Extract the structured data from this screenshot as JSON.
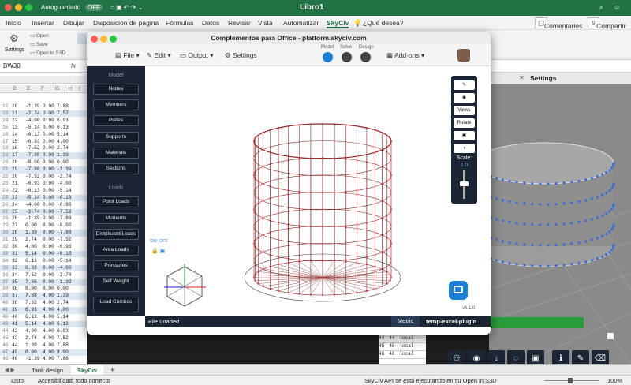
{
  "excel": {
    "autosave_label": "Autoguardado",
    "autosave_state": "OFF",
    "title": "Libro1",
    "tabs": [
      "Inicio",
      "Insertar",
      "Dibujar",
      "Disposición de página",
      "Fórmulas",
      "Datos",
      "Revisar",
      "Vista",
      "Automatizar",
      "SkyCiv"
    ],
    "active_tab": "SkyCiv",
    "tell_me": "¿Qué desea?",
    "comments_label": "Comentarios",
    "share_label": "Compartir",
    "ribbon": {
      "settings": "Settings",
      "open": "Open",
      "save": "Save",
      "open_s3d": "Open in S3D"
    },
    "name_box": "BW30",
    "fx": "fx",
    "col_headers": [
      "D",
      "E",
      "F",
      "G",
      "H",
      "I"
    ],
    "sheet_tabs": [
      "Tank design",
      "SkyCiv"
    ],
    "active_sheet": "SkyCiv",
    "status_ready": "Listo",
    "status_accessibility": "Accesibilidad: todo correcto",
    "status_plugin": "SkyCiv API se está ejecutando en su Open in S3D",
    "zoom": "100%",
    "rows": [
      [
        "12",
        "10",
        "-1.39",
        "0.00",
        "7.88"
      ],
      [
        "13",
        "11",
        "-2.74",
        "0.00",
        "7.52"
      ],
      [
        "14",
        "12",
        "-4.00",
        "0.00",
        "6.93"
      ],
      [
        "15",
        "13",
        "-5.14",
        "0.00",
        "6.13"
      ],
      [
        "16",
        "14",
        "-6.13",
        "0.00",
        "5.14"
      ],
      [
        "17",
        "15",
        "-6.93",
        "0.00",
        "4.00"
      ],
      [
        "18",
        "16",
        "-7.52",
        "0.00",
        "2.74"
      ],
      [
        "19",
        "17",
        "-7.88",
        "0.00",
        "1.39"
      ],
      [
        "20",
        "18",
        "-8.00",
        "0.00",
        "0.00"
      ],
      [
        "21",
        "19",
        "-7.88",
        "0.00",
        "-1.39"
      ],
      [
        "22",
        "20",
        "-7.52",
        "0.00",
        "-2.74"
      ],
      [
        "23",
        "21",
        "-6.93",
        "0.00",
        "-4.00"
      ],
      [
        "24",
        "22",
        "-6.13",
        "0.00",
        "-5.14"
      ],
      [
        "25",
        "23",
        "-5.14",
        "0.00",
        "-6.13"
      ],
      [
        "26",
        "24",
        "-4.00",
        "0.00",
        "-6.93"
      ],
      [
        "27",
        "25",
        "-2.74",
        "0.00",
        "-7.52"
      ],
      [
        "28",
        "26",
        "-1.39",
        "0.00",
        "-7.88"
      ],
      [
        "29",
        "27",
        "0.00",
        "0.00",
        "-8.00"
      ],
      [
        "30",
        "28",
        "1.39",
        "0.00",
        "-7.88"
      ],
      [
        "31",
        "29",
        "2.74",
        "0.00",
        "-7.52"
      ],
      [
        "32",
        "30",
        "4.00",
        "0.00",
        "-6.93"
      ],
      [
        "33",
        "31",
        "5.14",
        "0.00",
        "-6.13"
      ],
      [
        "34",
        "32",
        "6.13",
        "0.00",
        "-5.14"
      ],
      [
        "35",
        "33",
        "6.93",
        "0.00",
        "-4.00"
      ],
      [
        "36",
        "34",
        "7.52",
        "0.00",
        "-2.74"
      ],
      [
        "37",
        "35",
        "7.86",
        "0.00",
        "-1.39"
      ],
      [
        "38",
        "36",
        "8.00",
        "0.00",
        "0.00"
      ],
      [
        "39",
        "37",
        "7.88",
        "4.00",
        "1.39"
      ],
      [
        "40",
        "38",
        "7.52",
        "4.00",
        "2.74"
      ],
      [
        "41",
        "39",
        "6.93",
        "4.00",
        "4.00"
      ],
      [
        "42",
        "40",
        "6.13",
        "4.00",
        "5.14"
      ],
      [
        "43",
        "41",
        "5.14",
        "4.00",
        "6.13"
      ],
      [
        "44",
        "42",
        "4.00",
        "4.00",
        "6.93"
      ],
      [
        "45",
        "43",
        "2.74",
        "4.00",
        "7.52"
      ],
      [
        "46",
        "44",
        "1.39",
        "4.00",
        "7.88"
      ],
      [
        "47",
        "45",
        "0.00",
        "4.00",
        "8.00"
      ],
      [
        "48",
        "46",
        "-1.39",
        "4.00",
        "7.88"
      ]
    ],
    "right_cells": [
      [
        "44",
        "44",
        "local"
      ],
      [
        "45",
        "45",
        "local"
      ],
      [
        "46",
        "46",
        "local"
      ]
    ]
  },
  "plugin": {
    "title": "Complementos para Office - platform.skyciv.com",
    "menu": [
      "File",
      "Edit",
      "Output",
      "Settings"
    ],
    "steps": [
      "Model",
      "Solve",
      "Design"
    ],
    "addons": "Add-ons",
    "side_model_header": "Model",
    "side_model": [
      "Nodes",
      "Members",
      "Plates",
      "Supports",
      "Materials",
      "Sections"
    ],
    "side_loads_header": "Loads",
    "side_loads": [
      "Point Loads",
      "Moments",
      "Distributed Loads",
      "Area Loads",
      "Pressures",
      "Self Weight",
      "Load Combos"
    ],
    "sw_label": "SW: OFF",
    "view_tools": [
      "Views",
      "Rotate"
    ],
    "scale_label": "Scale:",
    "scale_value": "1.0",
    "version": "v6.1.0",
    "status": "File Loaded",
    "units": "Metric",
    "plugin_name": "temp-excel-plugin"
  },
  "right_panel": {
    "title": "Settings"
  }
}
